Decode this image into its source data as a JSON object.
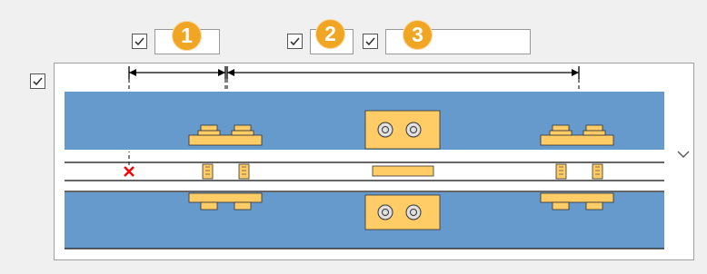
{
  "checkboxes": [
    {
      "id": "cb1",
      "checked": true
    },
    {
      "id": "cb2",
      "checked": true
    },
    {
      "id": "cb3",
      "checked": true
    },
    {
      "id": "cb-row",
      "checked": true
    }
  ],
  "fields": [
    {
      "id": "field1",
      "value": ""
    },
    {
      "id": "field2",
      "value": ""
    },
    {
      "id": "field3",
      "value": ""
    }
  ],
  "badges": [
    "1",
    "2",
    "3"
  ],
  "colors": {
    "band_blue": "#6699cc",
    "block_orange": "#ffcc66",
    "badge_orange": "#f0a623",
    "marker_red": "#ff0000"
  },
  "icons": {
    "checkmark": "check-icon",
    "expand": "chevron-down-icon",
    "marker": "x-marker-icon"
  }
}
